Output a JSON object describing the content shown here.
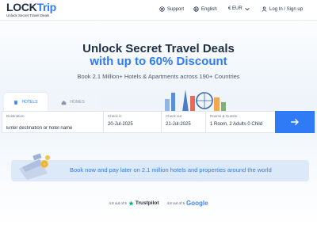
{
  "header": {
    "logo_lock": "LOCK",
    "logo_trip": "Trip",
    "tagline": "Unlock Secret Travel Deals",
    "support": "Support",
    "language": "English",
    "currency": "€  EUR",
    "login": "Log In / Sign up"
  },
  "hero": {
    "title_line1": "Unlock Secret Travel Deals",
    "title_line2": "with up to 60% Discount",
    "subtitle": "Book 2.1 Million+ Hotels & Apartments across 190+ Countries"
  },
  "tabs": [
    {
      "label": "HOTELS",
      "active": true
    },
    {
      "label": "HOMES",
      "active": false
    }
  ],
  "search": {
    "destination_label": "Destination",
    "destination_placeholder": "Enter destination or hotel name",
    "checkin_label": "Check in",
    "checkin_value": "20-Jul-2025",
    "checkout_label": "Check out",
    "checkout_value": "21-Jul-2025",
    "guests_label": "Rooms & Guests",
    "guests_value": "1 Room, 2 Adults 0 Child"
  },
  "promo": {
    "text": "Book now and pay later on 2.1 million hotels and properties around the world"
  },
  "ratings": {
    "trustpilot_score": "4.8 out of 5",
    "trustpilot_name": "Trustpilot",
    "google_score": "4.8 out of 5",
    "google_name": "Google"
  },
  "colors": {
    "brand": "#2f7bf5",
    "dark": "#1f2f46",
    "promo_bg": "#dce9f9"
  }
}
